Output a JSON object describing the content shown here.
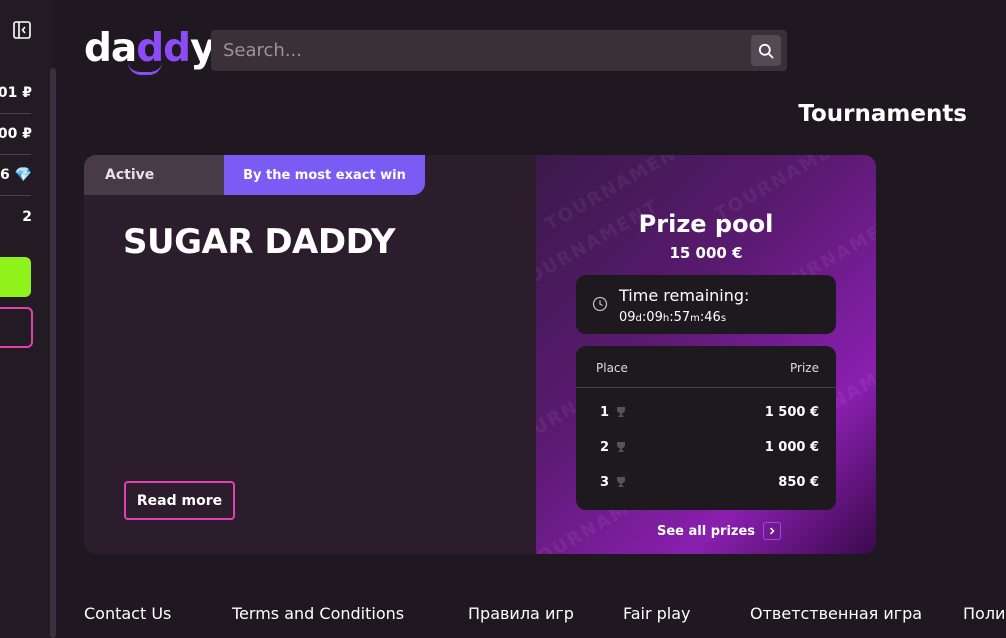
{
  "sidebar": {
    "balances": [
      {
        "text": "01 ₽"
      },
      {
        "text": "00 ₽"
      },
      {
        "text": "6 💎"
      },
      {
        "text": "2"
      }
    ]
  },
  "header": {
    "logo_text": "daddy",
    "search": {
      "placeholder": "Search..."
    }
  },
  "page_title": "Tournaments",
  "tournament": {
    "status_tab": "Active",
    "mode_tab": "By the most exact win",
    "name": "SUGAR DADDY",
    "read_more": "Read more",
    "prize_pool": {
      "title": "Prize pool",
      "amount": "15 000 €"
    },
    "timer": {
      "label": "Time remaining:",
      "days": "09",
      "hours": "09",
      "minutes": "57",
      "seconds": "46",
      "d_unit": "d",
      "h_unit": "h",
      "m_unit": "m",
      "s_unit": "s"
    },
    "prize_table": {
      "place_header": "Place",
      "prize_header": "Prize",
      "rows": [
        {
          "place": "1",
          "prize": "1 500 €"
        },
        {
          "place": "2",
          "prize": "1 000 €"
        },
        {
          "place": "3",
          "prize": "850 €"
        }
      ]
    },
    "see_all_prizes": "See all prizes",
    "watermark": "TOURNAMENT"
  },
  "footer": {
    "links": [
      {
        "label": "Contact Us"
      },
      {
        "label": "Terms and Conditions"
      },
      {
        "label": "Правила игр"
      },
      {
        "label": "Fair play"
      },
      {
        "label": "Ответственная игра"
      },
      {
        "label": "Полит"
      }
    ]
  },
  "colors": {
    "accent_purple": "#7a5cf5",
    "green_button": "#8ff21a",
    "pink_outline": "#e23fb0"
  }
}
